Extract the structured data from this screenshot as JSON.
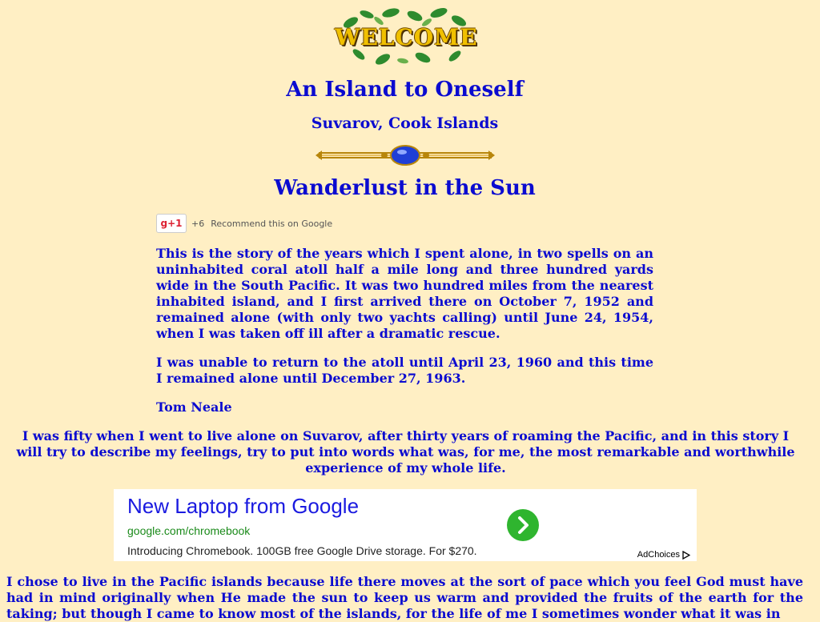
{
  "logo": {
    "text": "WELCOME"
  },
  "titles": {
    "main": "An Island to Oneself",
    "location": "Suvarov, Cook Islands",
    "chapter": "Wanderlust in the Sun"
  },
  "gplus": {
    "button_label": "g+1",
    "count": "+6",
    "text": "Recommend this on Google"
  },
  "story": {
    "p1": "This is the story of the years which I spent alone, in two spells on an uninhabited coral atoll half a mile long and three hundred yards wide in the South Pacific. It was two hundred miles from the nearest inhabited island, and I first arrived there on October 7, 1952 and remained alone (with only two yachts calling) until June 24, 1954, when I was taken off ill after a dramatic rescue.",
    "p2": "I was unable to return to the atoll until April 23, 1960 and this time I remained alone until December 27, 1963.",
    "author": "Tom Neale",
    "p4": "I was fifty when I went to live alone on Suvarov, after thirty years of roaming the Pacific, and in this story I will try to describe my feelings, try to put into words what was, for me, the most remarkable and worthwhile experience of my whole life.",
    "p5": "I chose to live in the Pacific islands because life there moves at the sort of pace which you feel God must have had in mind originally when He made the sun to keep us warm and provided the fruits of the earth for the taking; but though I came to know most of the islands, for the life of me I sometimes wonder what it was in"
  },
  "ad": {
    "headline": "New Laptop from Google",
    "url": "google.com/chromebook",
    "description": "Introducing Chromebook. 100GB free Google Drive storage. For $270.",
    "choices": "AdChoices"
  }
}
